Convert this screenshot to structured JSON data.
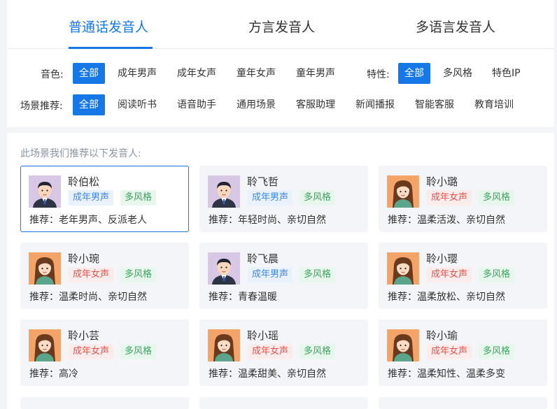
{
  "tabs": [
    {
      "label": "普通话发音人",
      "active": true
    },
    {
      "label": "方言发音人",
      "active": false
    },
    {
      "label": "多语言发音人",
      "active": false
    }
  ],
  "filters": {
    "timbre_label": "音色:",
    "timbre_options": [
      "全部",
      "成年男声",
      "成年女声",
      "童年女声",
      "童年男声"
    ],
    "feature_label": "特性:",
    "feature_options": [
      "全部",
      "多风格",
      "特色IP"
    ],
    "scene_label": "场景推荐:",
    "scene_options": [
      "全部",
      "阅读听书",
      "语音助手",
      "通用场景",
      "客服助理",
      "新闻播报",
      "智能客服",
      "教育培训"
    ]
  },
  "section_hint": "此场景我们推荐以下发音人:",
  "voices": [
    {
      "name": "聆伯松",
      "gender_tag": "成年男声",
      "gender": "male",
      "style_tag": "多风格",
      "recommend": "推荐：老年男声、反派老人",
      "selected": true
    },
    {
      "name": "聆飞哲",
      "gender_tag": "成年男声",
      "gender": "male",
      "style_tag": "多风格",
      "recommend": "推荐：年轻时尚、亲切自然",
      "selected": false
    },
    {
      "name": "聆小璐",
      "gender_tag": "成年女声",
      "gender": "female",
      "style_tag": "多风格",
      "recommend": "推荐：温柔活泼、亲切自然",
      "selected": false
    },
    {
      "name": "聆小琬",
      "gender_tag": "成年女声",
      "gender": "female",
      "style_tag": "多风格",
      "recommend": "推荐：温柔时尚、亲切自然",
      "selected": false
    },
    {
      "name": "聆飞晨",
      "gender_tag": "成年男声",
      "gender": "male",
      "style_tag": "多风格",
      "recommend": "推荐：青春温暖",
      "selected": false
    },
    {
      "name": "聆小璎",
      "gender_tag": "成年女声",
      "gender": "female",
      "style_tag": "多风格",
      "recommend": "推荐：温柔放松、亲切自然",
      "selected": false
    },
    {
      "name": "聆小芸",
      "gender_tag": "成年女声",
      "gender": "female",
      "style_tag": "多风格",
      "recommend": "推荐：高冷",
      "selected": false
    },
    {
      "name": "聆小瑶",
      "gender_tag": "成年女声",
      "gender": "female",
      "style_tag": "多风格",
      "recommend": "推荐：温柔甜美、亲切自然",
      "selected": false
    },
    {
      "name": "聆小瑜",
      "gender_tag": "成年女声",
      "gender": "female",
      "style_tag": "多风格",
      "recommend": "推荐：温柔知性、温柔多变",
      "selected": false
    }
  ],
  "colors": {
    "accent": "#1677e6",
    "male_tag": "#3f87e8",
    "female_tag": "#e4534a",
    "style_tag": "#3aa35f"
  }
}
